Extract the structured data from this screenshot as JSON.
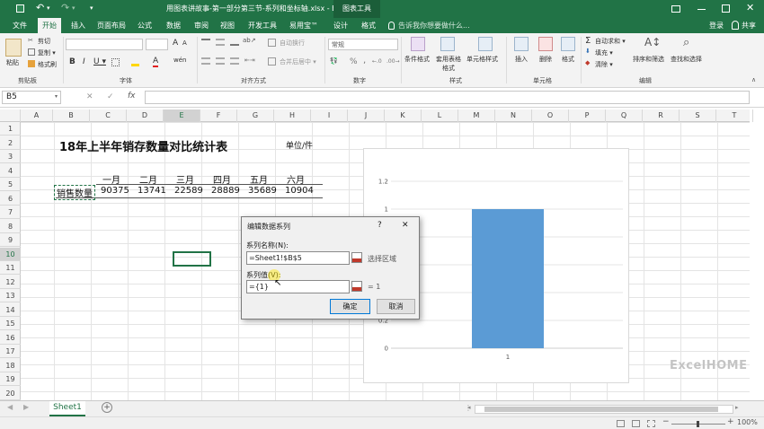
{
  "window": {
    "title": "用图表讲故事-第一部分第三节-系列和坐标轴.xlsx - Excel",
    "context_tab": "图表工具"
  },
  "quick_access": {
    "undo": "↶",
    "redo": "↷",
    "dropdown": "▾"
  },
  "ribbon_tabs": [
    {
      "label": "文件"
    },
    {
      "label": "开始"
    },
    {
      "label": "插入"
    },
    {
      "label": "页面布局"
    },
    {
      "label": "公式"
    },
    {
      "label": "数据"
    },
    {
      "label": "审阅"
    },
    {
      "label": "视图"
    },
    {
      "label": "开发工具"
    },
    {
      "label": "易用宝™"
    },
    {
      "label": "设计"
    },
    {
      "label": "格式"
    }
  ],
  "tell_me": "告诉我你想要做什么...",
  "account": {
    "login": "登录",
    "share": "共享"
  },
  "ribbon": {
    "clipboard": {
      "paste": "粘贴",
      "cut": "剪切",
      "copy": "复制 ▾",
      "format_painter": "格式刷",
      "label": "剪贴板"
    },
    "font": {
      "label": "字体",
      "bold": "B",
      "italic": "I",
      "underline": "U ▾",
      "grow": "A",
      "shrink": "A",
      "wen": "wén"
    },
    "alignment": {
      "label": "对齐方式",
      "wrap": "自动换行",
      "merge": "合并后居中 ▾"
    },
    "number": {
      "label": "数字",
      "format": "常规",
      "percent": "%",
      "comma": ",",
      "currency": "▾"
    },
    "styles": {
      "label": "样式",
      "conditional": "条件格式",
      "table": "套用表格格式",
      "cell_styles": "单元格样式"
    },
    "cells": {
      "label": "单元格",
      "insert": "插入",
      "delete": "删除",
      "format": "格式"
    },
    "editing": {
      "label": "编辑",
      "autosum": "自动求和 ▾",
      "fill": "填充 ▾",
      "clear": "清除 ▾",
      "sort": "排序和筛选",
      "find": "查找和选择"
    }
  },
  "formula_bar": {
    "name_box": "B5",
    "cancel": "✕",
    "enter": "✓",
    "fx": "fx",
    "value": ""
  },
  "columns": [
    "A",
    "B",
    "C",
    "D",
    "E",
    "F",
    "G",
    "H",
    "I",
    "J",
    "K",
    "L",
    "M",
    "N",
    "O",
    "P",
    "Q",
    "R",
    "S",
    "T"
  ],
  "rows": [
    "1",
    "2",
    "3",
    "4",
    "5",
    "6",
    "7",
    "8",
    "9",
    "10",
    "11",
    "12",
    "13",
    "14",
    "15",
    "16",
    "17",
    "18",
    "19",
    "20"
  ],
  "sheet": {
    "title": "18年上半年销存数量对比统计表",
    "unit": "单位/件",
    "months": [
      "一月",
      "二月",
      "三月",
      "四月",
      "五月",
      "六月"
    ],
    "row_label": "销售数量",
    "values": [
      "90375",
      "13741",
      "22589",
      "28889",
      "35689",
      "10904"
    ]
  },
  "chart_data": {
    "type": "bar",
    "categories": [
      "1"
    ],
    "values": [
      1
    ],
    "ylim": [
      0,
      1.2
    ],
    "yticks": [
      "0",
      "0.2",
      "0.4",
      "0.6",
      "0.8",
      "1",
      "1.2"
    ],
    "bar_color": "#5b9bd5",
    "grid": true
  },
  "dialog": {
    "title": "编辑数据系列",
    "help": "?",
    "close": "✕",
    "name_label": "系列名称(N):",
    "name_value": "=Sheet1!$B$5",
    "name_hint": "选择区域",
    "values_label": "系列值(V):",
    "values_value": "={1}",
    "values_hint": "= 1",
    "ok": "确定",
    "cancel": "取消"
  },
  "sheet_tabs": [
    {
      "label": "Sheet1"
    }
  ],
  "add_sheet": "+",
  "status": {
    "zoom": "100%",
    "minus": "−",
    "plus": "+"
  },
  "watermark": "ExcelHOME",
  "colors": {
    "excel_green": "#217346",
    "bar": "#5b9bd5",
    "selection": "#217346"
  }
}
